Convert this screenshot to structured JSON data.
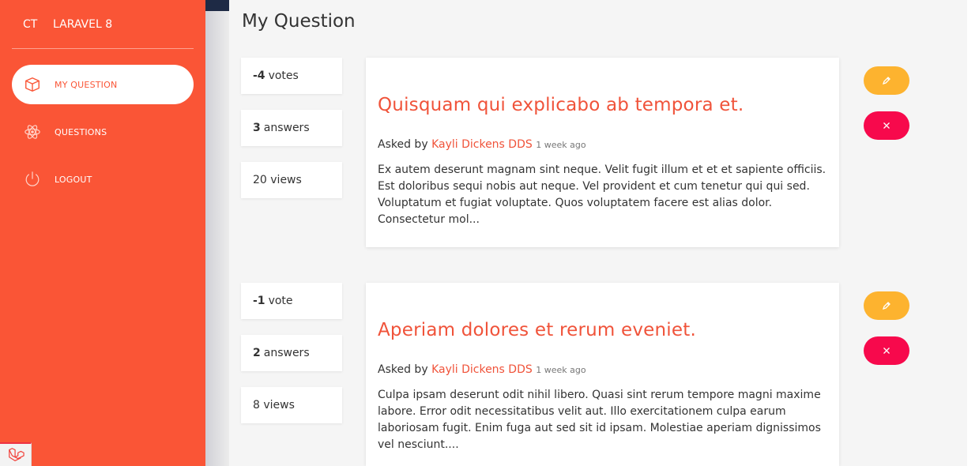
{
  "brand": {
    "mini": "CT",
    "name": "LARAVEL 8"
  },
  "sidebar": {
    "items": [
      {
        "label": "MY QUESTION",
        "icon": "cube-icon",
        "active": true
      },
      {
        "label": "QUESTIONS",
        "icon": "atom-icon",
        "active": false
      },
      {
        "label": "LOGOUT",
        "icon": "power-icon",
        "active": false
      }
    ]
  },
  "page": {
    "title": "My Question"
  },
  "questions": [
    {
      "votes_count": "-4",
      "votes_label": "votes",
      "answers_count": "3",
      "answers_label": "answers",
      "views": "20 views",
      "title": "Quisquam qui explicabo ab tempora et.",
      "asked_by": "Asked by",
      "author": "Kayli Dickens DDS",
      "time": "1 week ago",
      "excerpt": "Ex autem deserunt magnam sint neque. Velit fugit illum et et et sapiente officiis. Est doloribus sequi nobis aut neque. Vel provident et cum tenetur qui qui sed. Voluptatum et fugiat voluptate. Quos voluptatem facere est alias dolor. Consectetur mol..."
    },
    {
      "votes_count": "-1",
      "votes_label": "vote",
      "answers_count": "2",
      "answers_label": "answers",
      "views": "8 views",
      "title": "Aperiam dolores et rerum eveniet.",
      "asked_by": "Asked by",
      "author": "Kayli Dickens DDS",
      "time": "1 week ago",
      "excerpt": "Culpa ipsam deserunt odit nihil libero. Quasi sint rerum tempore magni maxime labore. Error odit necessitatibus velit aut. Illo exercitationem culpa earum laboriosam fugit. Enim fuga aut sed sit id ipsam. Molestiae aperiam dignissimos vel nesciunt...."
    }
  ],
  "colors": {
    "sidebar": "#fa5536",
    "accent": "#f0533a",
    "edit": "#fdb32f",
    "delete": "#f7094c"
  }
}
